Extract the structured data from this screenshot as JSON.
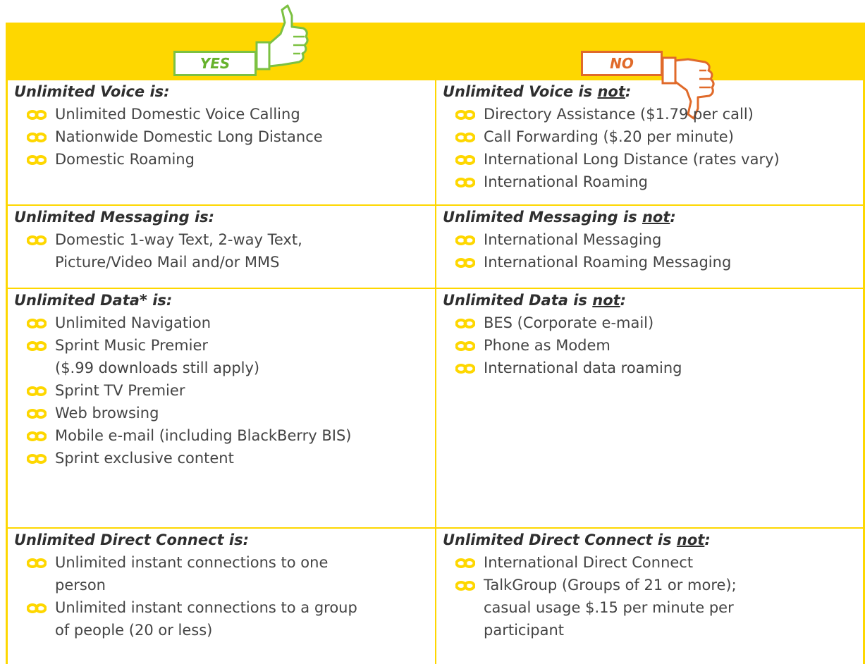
{
  "header": {
    "yes_label": "YES",
    "no_label": "NO",
    "bar_color": "#fed700",
    "yes_color": "#7cc142",
    "no_color": "#e06a2a"
  },
  "rows": [
    {
      "left": {
        "heading": "Unlimited Voice is:",
        "items": [
          "Unlimited Domestic Voice Calling",
          "Nationwide Domestic Long Distance",
          "Domestic Roaming"
        ]
      },
      "right": {
        "heading_prefix": "Unlimited Voice is ",
        "heading_emph": "not",
        "heading_suffix": ":",
        "items": [
          "Directory Assistance ($1.79 per call)",
          "Call Forwarding ($.20 per minute)",
          "International Long Distance (rates vary)",
          "International Roaming"
        ]
      }
    },
    {
      "left": {
        "heading": "Unlimited Messaging is:",
        "items": [
          "Domestic 1-way Text, 2-way Text, Picture/Video Mail and/or MMS"
        ]
      },
      "right": {
        "heading_prefix": "Unlimited Messaging is ",
        "heading_emph": "not",
        "heading_suffix": ":",
        "items": [
          "International Messaging",
          "International Roaming Messaging"
        ]
      }
    },
    {
      "left": {
        "heading": "Unlimited Data* is:",
        "items": [
          "Unlimited Navigation",
          "Sprint Music Premier",
          "($.99 downloads still apply)",
          "Sprint TV Premier",
          "Web browsing",
          "Mobile e-mail (including BlackBerry BIS)",
          "Sprint exclusive content"
        ]
      },
      "right": {
        "heading_prefix": "Unlimited Data is ",
        "heading_emph": "not",
        "heading_suffix": ":",
        "items": [
          "BES (Corporate e-mail)",
          "Phone as Modem",
          "International data roaming"
        ]
      }
    },
    {
      "left": {
        "heading": "Unlimited Direct Connect is:",
        "items": [
          "Unlimited instant connections to one person",
          "Unlimited instant connections to a group of people (20 or less)"
        ]
      },
      "right": {
        "heading_prefix": "Unlimited Direct Connect is ",
        "heading_emph": "not",
        "heading_suffix": ":",
        "items": [
          "International Direct Connect",
          "TalkGroup (Groups of 21 or more); casual usage $.15 per minute per participant"
        ]
      }
    }
  ]
}
